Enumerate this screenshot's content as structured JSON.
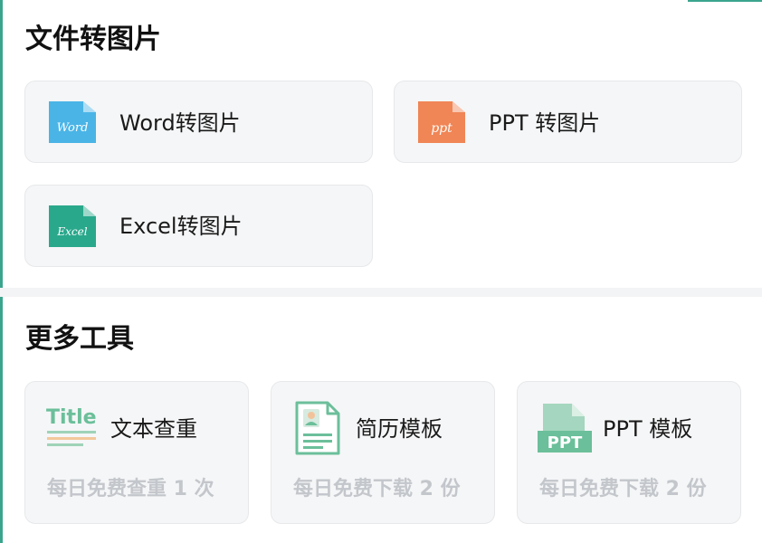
{
  "convert_section": {
    "title": "文件转图片",
    "items": [
      {
        "label": "Word转图片",
        "icon": "word-file-icon",
        "icon_text": "Word",
        "color": "#4ab4e6"
      },
      {
        "label": "PPT 转图片",
        "icon": "ppt-file-icon",
        "icon_text": "ppt",
        "color": "#f08555"
      },
      {
        "label": "Excel转图片",
        "icon": "excel-file-icon",
        "icon_text": "Excel",
        "color": "#2aa88c"
      }
    ]
  },
  "tools_section": {
    "title": "更多工具",
    "items": [
      {
        "label": "文本查重",
        "sub": "每日免费查重 1 次",
        "icon": "title-text-icon",
        "icon_text": "Title"
      },
      {
        "label": "简历模板",
        "sub": "每日免费下载 2 份",
        "icon": "resume-document-icon"
      },
      {
        "label": "PPT 模板",
        "sub": "每日免费下载 2 份",
        "icon": "ppt-template-icon",
        "icon_text": "PPT"
      }
    ]
  },
  "colors": {
    "accent_green": "#6bbf9a",
    "card_bg": "#f5f6f7",
    "sub_text": "#c3c6cb"
  }
}
